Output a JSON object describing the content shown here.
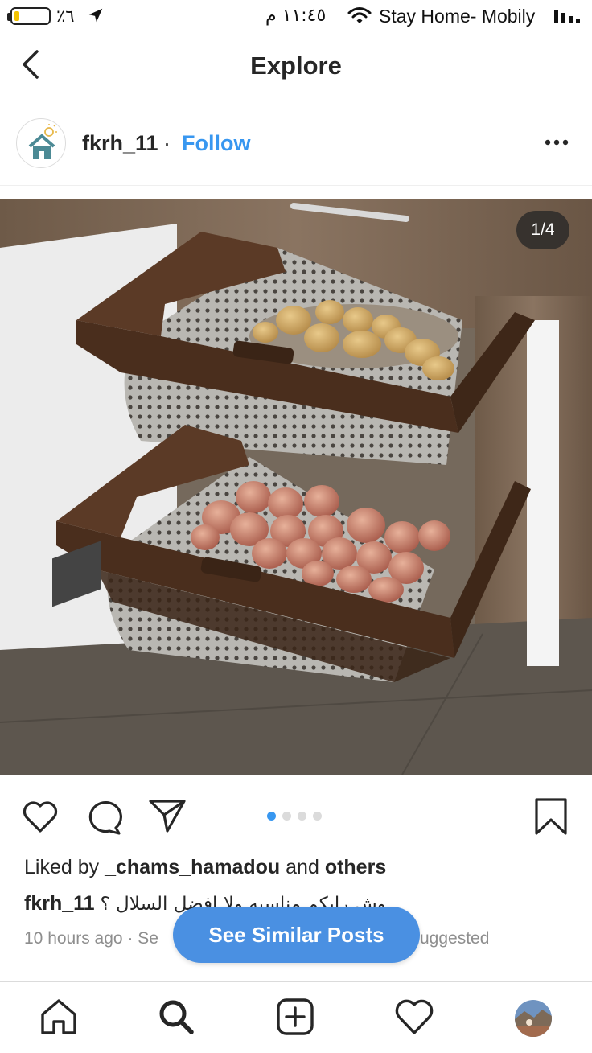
{
  "status_bar": {
    "battery_percent": "٪٦",
    "time": "١١:٤٥ م",
    "carrier": "Stay Home- Mobily"
  },
  "nav": {
    "title": "Explore"
  },
  "post": {
    "username": "fkrh_11",
    "separator": "·",
    "follow_label": "Follow",
    "image_counter": "1/4",
    "carousel": {
      "total": 4,
      "active_index": 0
    },
    "liked_by_prefix": "Liked by ",
    "liked_by_user": "_chams_hamadou",
    "liked_by_middle": " and ",
    "liked_by_others": "others",
    "caption_user": "fkrh_11",
    "caption_text": "وش رايكم مناسبه ولا افضل السلال ؟",
    "time_ago": "10 hours ago",
    "meta_dot": "·",
    "meta_partial_left": "Se",
    "meta_partial_right": "uggested"
  },
  "see_similar": {
    "label": "See Similar Posts"
  },
  "icons": {
    "back": "chevron-left-icon",
    "more": "more-horizontal-icon",
    "like": "heart-icon",
    "comment": "comment-icon",
    "share": "send-icon",
    "save": "bookmark-icon",
    "home": "home-icon",
    "search": "search-icon",
    "add": "add-post-icon",
    "activity": "heart-icon",
    "profile": "profile-avatar"
  },
  "colors": {
    "link": "#3897f0",
    "button": "#4a90e2",
    "text": "#262626",
    "secondary_text": "#8e8e8e"
  }
}
